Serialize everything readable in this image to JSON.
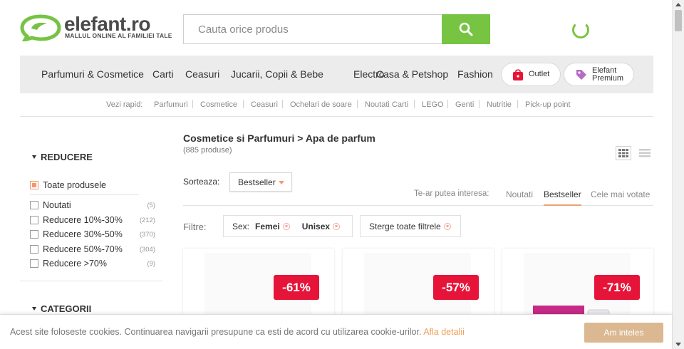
{
  "brand": {
    "name": "elefant.ro",
    "tagline": "MALLUL ONLINE AL FAMILIEI TALE",
    "accent": "#76c442"
  },
  "search": {
    "placeholder": "Cauta orice produs",
    "value": "",
    "button_icon": "search-icon"
  },
  "main_nav": {
    "items": [
      "Parfumuri & Cosmetice",
      "Carti",
      "Ceasuri",
      "Jucarii, Copii & Bebe",
      "Electro",
      "Casa & Petshop",
      "Fashion"
    ],
    "outlet": {
      "label": "Outlet",
      "icon": "shopping-bag-icon"
    },
    "premium": {
      "label_line1": "Elefant",
      "label_line2": "Premium",
      "icon": "tag-icon"
    }
  },
  "quick_links": {
    "label": "Vezi rapid:",
    "items": [
      "Parfumuri",
      "Cosmetice",
      "Ceasuri",
      "Ochelari de soare",
      "Noutati Carti",
      "LEGO",
      "Genti",
      "Nutritie",
      "Pick-up point"
    ]
  },
  "sidebar": {
    "reducere": {
      "title": "REDUCERE",
      "all_label": "Toate produsele",
      "options": [
        {
          "label": "Noutati",
          "count": "(5)"
        },
        {
          "label": "Reducere 10%-30%",
          "count": "(212)"
        },
        {
          "label": "Reducere 30%-50%",
          "count": "(370)"
        },
        {
          "label": "Reducere 50%-70%",
          "count": "(304)"
        },
        {
          "label": "Reducere >70%",
          "count": "(9)"
        }
      ]
    },
    "categorii": {
      "title": "CATEGORII"
    }
  },
  "listing": {
    "breadcrumb": "Cosmetice si Parfumuri > Apa de parfum",
    "count": "(885 produse)",
    "sort_label": "Sorteaza:",
    "sort_value": "Bestseller",
    "interest_label": "Te-ar putea interesa:",
    "tabs": [
      "Noutati",
      "Bestseller",
      "Cele mai votate"
    ],
    "active_tab": "Bestseller",
    "filters_label": "Filtre:",
    "filter_sex_label": "Sex:",
    "filter_sex_values": [
      "Femei",
      "Unisex"
    ],
    "clear_filters": "Sterge toate filtrele",
    "products": [
      {
        "discount": "-61%"
      },
      {
        "discount": "-57%"
      },
      {
        "discount": "-71%"
      }
    ]
  },
  "cookie": {
    "message": "Acest site foloseste cookies. Continuarea navigarii presupune ca esti de acord cu utilizarea cookie-urilor.",
    "link": "Afla detalii",
    "accept": "Am inteles"
  }
}
